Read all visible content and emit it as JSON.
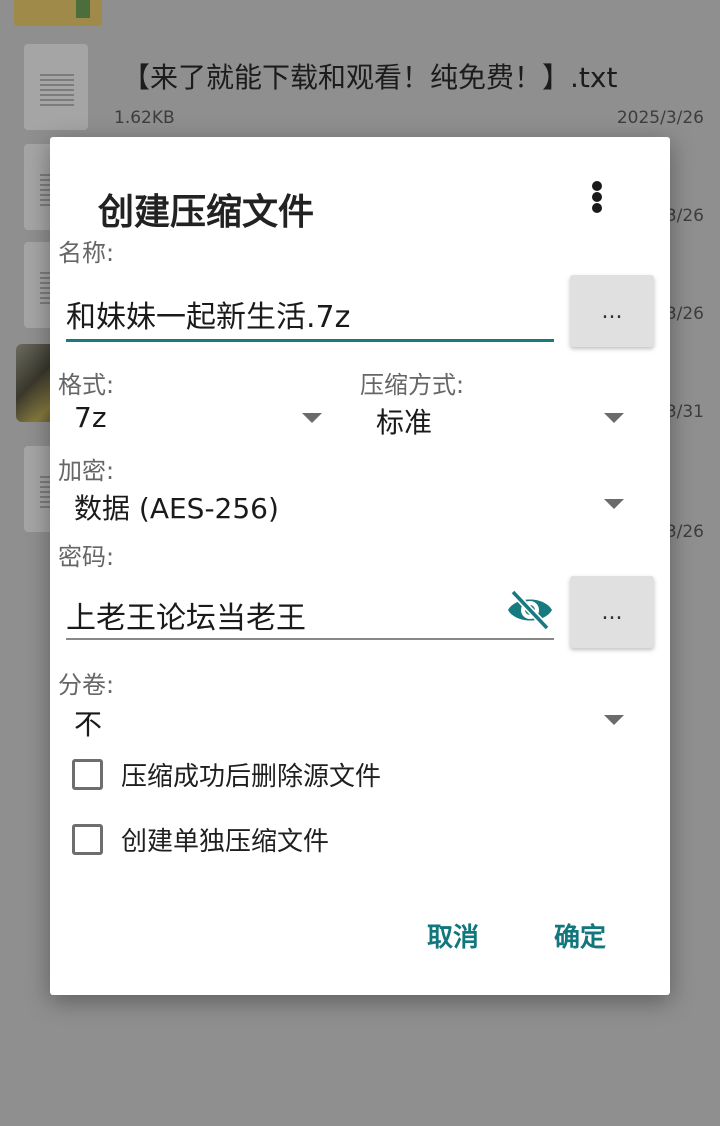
{
  "background": {
    "file_name": "【来了就能下载和观看！纯免费！】.txt",
    "file_size": "1.62KB",
    "file_date": "2025/3/26",
    "partial_dates": [
      "3/26",
      "3/26",
      "3/31",
      "3/26"
    ]
  },
  "dialog": {
    "title": "创建压缩文件",
    "name_label": "名称:",
    "name_value": "和妹妹一起新生活.7z",
    "browse_label": "...",
    "format_label": "格式:",
    "format_value": "7z",
    "method_label": "压缩方式:",
    "method_value": "标准",
    "encryption_label": "加密:",
    "encryption_value": "数据 (AES-256)",
    "password_label": "密码:",
    "password_value": "上老王论坛当老王",
    "password_more_label": "...",
    "split_label": "分卷:",
    "split_value": "不",
    "delete_source_label": "压缩成功后删除源文件",
    "separate_archive_label": "创建单独压缩文件",
    "cancel_label": "取消",
    "confirm_label": "确定"
  },
  "colors": {
    "accent": "#177a80",
    "overlay": "#8f8f8f"
  },
  "icons": {
    "more": "more-vert-icon",
    "password_visibility": "visibility-off-icon",
    "dropdown": "arrow-drop-down-icon",
    "file": "text-file-icon"
  }
}
